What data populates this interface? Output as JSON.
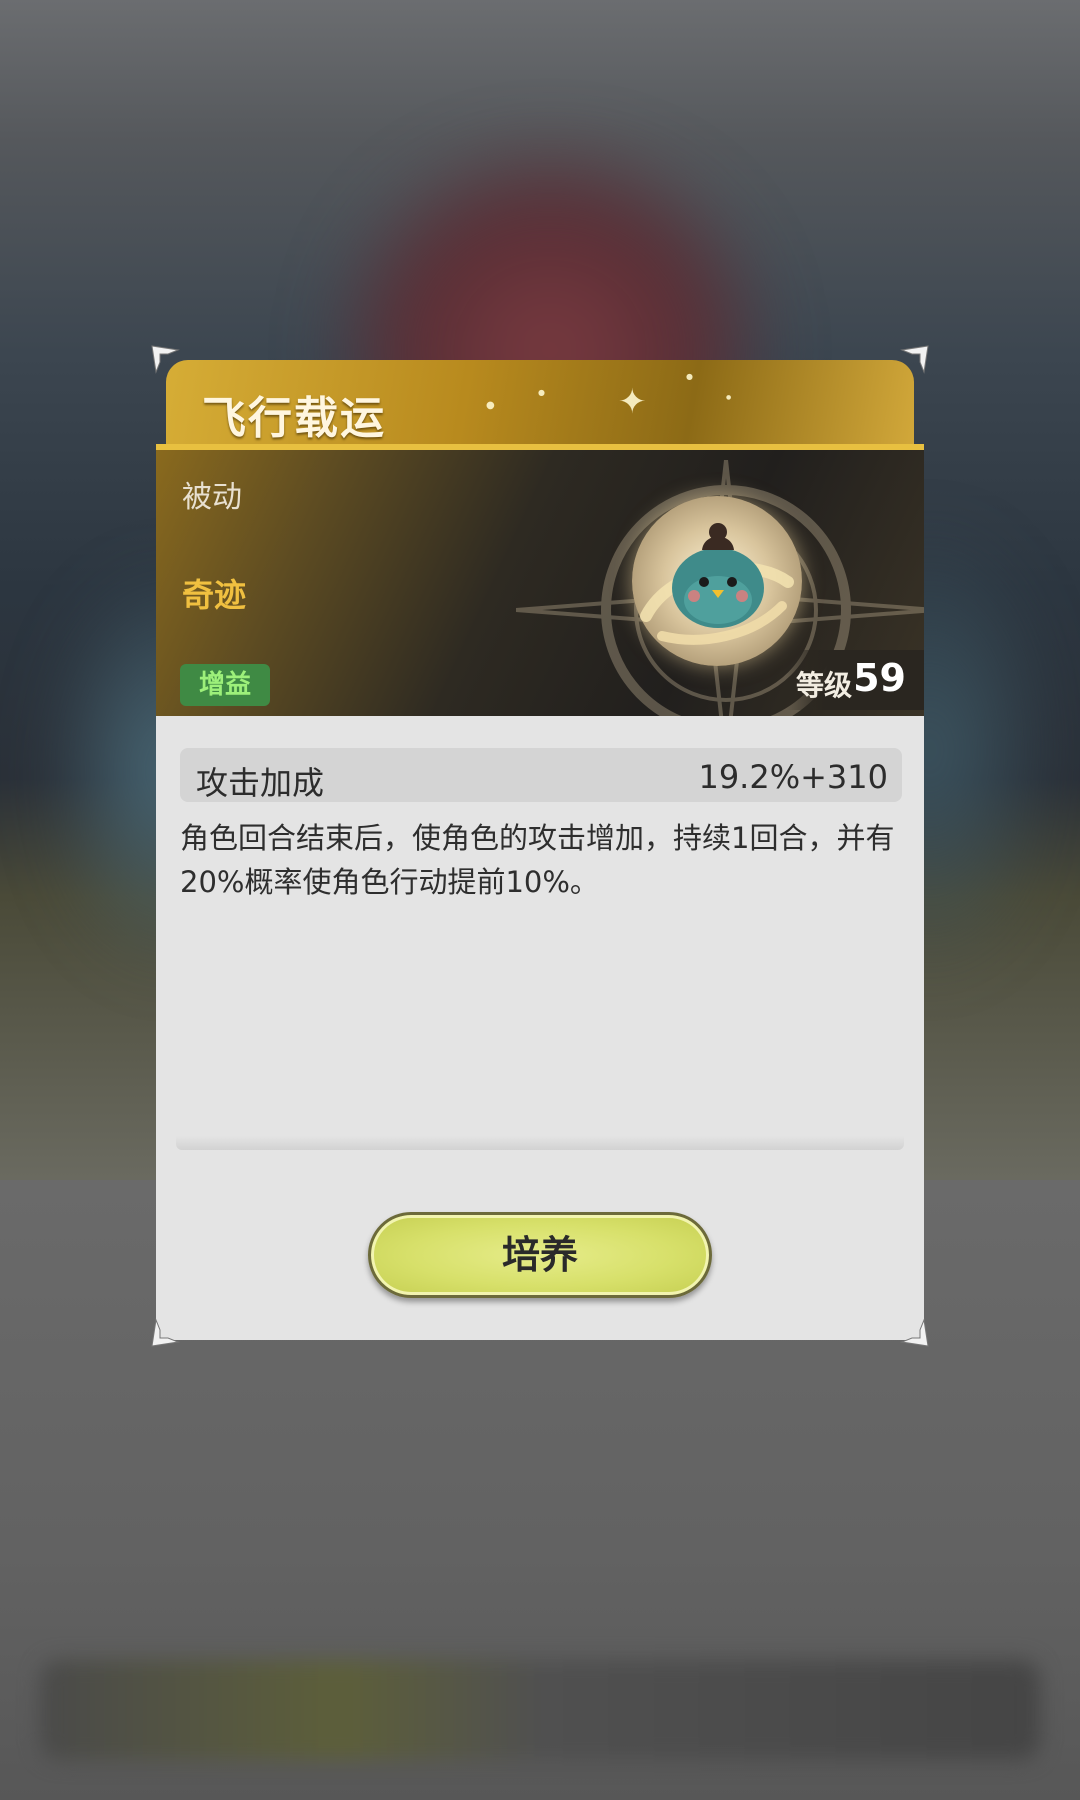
{
  "skill": {
    "title": "飞行载运",
    "type_label": "被动",
    "path_label": "奇迹",
    "effect_badge": "增益",
    "level_label": "等级",
    "level_value": "59"
  },
  "stat": {
    "name": "攻击加成",
    "value": "19.2%+310"
  },
  "description": "角色回合结束后，使角色的攻击增加，持续1回合，并有20%概率使角色行动提前10%。",
  "actions": {
    "train_label": "培养"
  },
  "icons": {
    "skill_icon": "green-bird-icon",
    "corner": "corner-ornament-icon"
  },
  "colors": {
    "gold": "#d6ad36",
    "path_text": "#f0c040",
    "badge_bg": "#3f8a44",
    "button": "#d7e06a"
  }
}
